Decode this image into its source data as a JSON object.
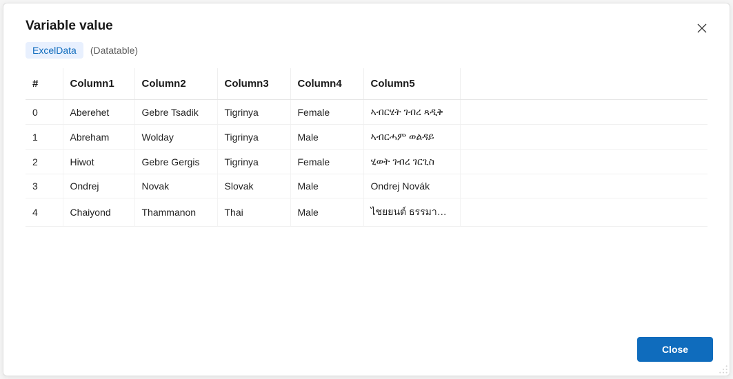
{
  "dialog": {
    "title": "Variable value",
    "close_button_label": "Close"
  },
  "variable": {
    "name": "ExcelData",
    "type": "(Datatable)"
  },
  "table": {
    "headers": {
      "index": "#",
      "c1": "Column1",
      "c2": "Column2",
      "c3": "Column3",
      "c4": "Column4",
      "c5": "Column5"
    },
    "rows": [
      {
        "idx": "0",
        "c1": "Aberehet",
        "c2": "Gebre Tsadik",
        "c3": "Tigrinya",
        "c4": "Female",
        "c5": "ኣብርሄት ገብረ ጻዲቅ"
      },
      {
        "idx": "1",
        "c1": "Abreham",
        "c2": "Wolday",
        "c3": "Tigrinya",
        "c4": "Male",
        "c5": "ኣብርሓም ወልዳይ"
      },
      {
        "idx": "2",
        "c1": "Hiwot",
        "c2": "Gebre Gergis",
        "c3": "Tigrinya",
        "c4": "Female",
        "c5": "ሂወት ገብረ ገርጊስ"
      },
      {
        "idx": "3",
        "c1": "Ondrej",
        "c2": "Novak",
        "c3": "Slovak",
        "c4": "Male",
        "c5": "Ondrej Novák"
      },
      {
        "idx": "4",
        "c1": "Chaiyond",
        "c2": "Thammanon",
        "c3": "Thai",
        "c4": "Male",
        "c5": "ไชยยนต์ ธรรมานนท์"
      }
    ]
  }
}
